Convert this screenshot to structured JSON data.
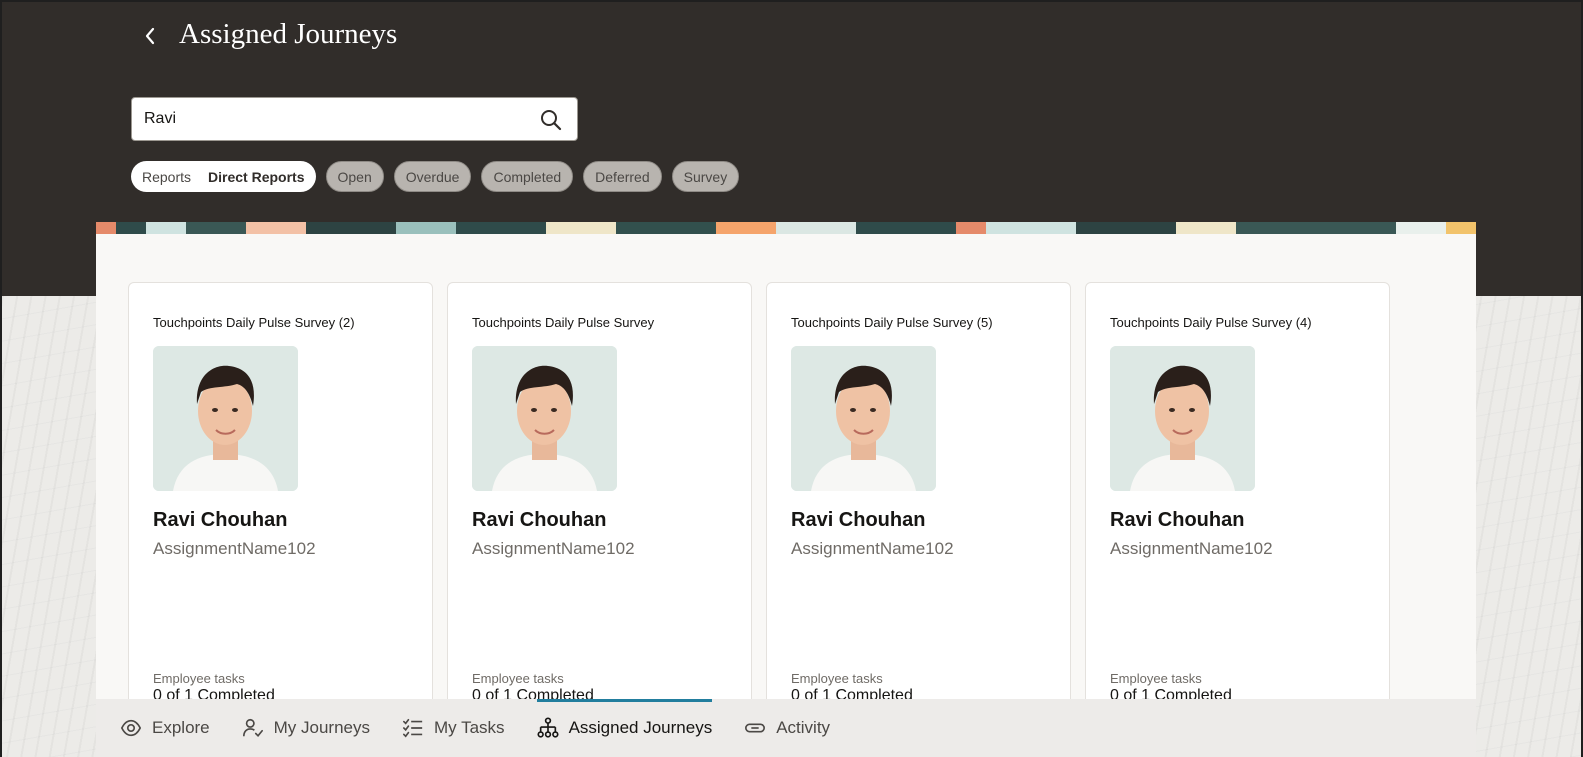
{
  "header": {
    "title": "Assigned Journeys",
    "back_label": "Back"
  },
  "search": {
    "value": "Ravi",
    "placeholder": "Search"
  },
  "filters": {
    "segment_reports": "Reports",
    "segment_direct_reports": "Direct Reports",
    "selected_segment": "Direct Reports",
    "chips": [
      "Open",
      "Overdue",
      "Completed",
      "Deferred",
      "Survey"
    ]
  },
  "cards": [
    {
      "title": "Touchpoints Daily Pulse Survey (2)",
      "name": "Ravi Chouhan",
      "assignment": "AssignmentName102",
      "tasks_label": "Employee tasks",
      "tasks_value": "0 of 1 Completed"
    },
    {
      "title": "Touchpoints Daily Pulse Survey",
      "name": "Ravi Chouhan",
      "assignment": "AssignmentName102",
      "tasks_label": "Employee tasks",
      "tasks_value": "0 of 1 Completed"
    },
    {
      "title": "Touchpoints Daily Pulse Survey (5)",
      "name": "Ravi Chouhan",
      "assignment": "AssignmentName102",
      "tasks_label": "Employee tasks",
      "tasks_value": "0 of 1 Completed"
    },
    {
      "title": "Touchpoints Daily Pulse Survey (4)",
      "name": "Ravi Chouhan",
      "assignment": "AssignmentName102",
      "tasks_label": "Employee tasks",
      "tasks_value": "0 of 1 Completed"
    }
  ],
  "nav": {
    "items": [
      {
        "label": "Explore",
        "icon": "eye-icon"
      },
      {
        "label": "My Journeys",
        "icon": "person-check-icon"
      },
      {
        "label": "My Tasks",
        "icon": "checklist-icon"
      },
      {
        "label": "Assigned Journeys",
        "icon": "hierarchy-icon"
      },
      {
        "label": "Activity",
        "icon": "link-icon"
      }
    ],
    "active": "Assigned Journeys"
  },
  "colors": {
    "header_bg": "#312d2a",
    "accent": "#227e9e"
  }
}
